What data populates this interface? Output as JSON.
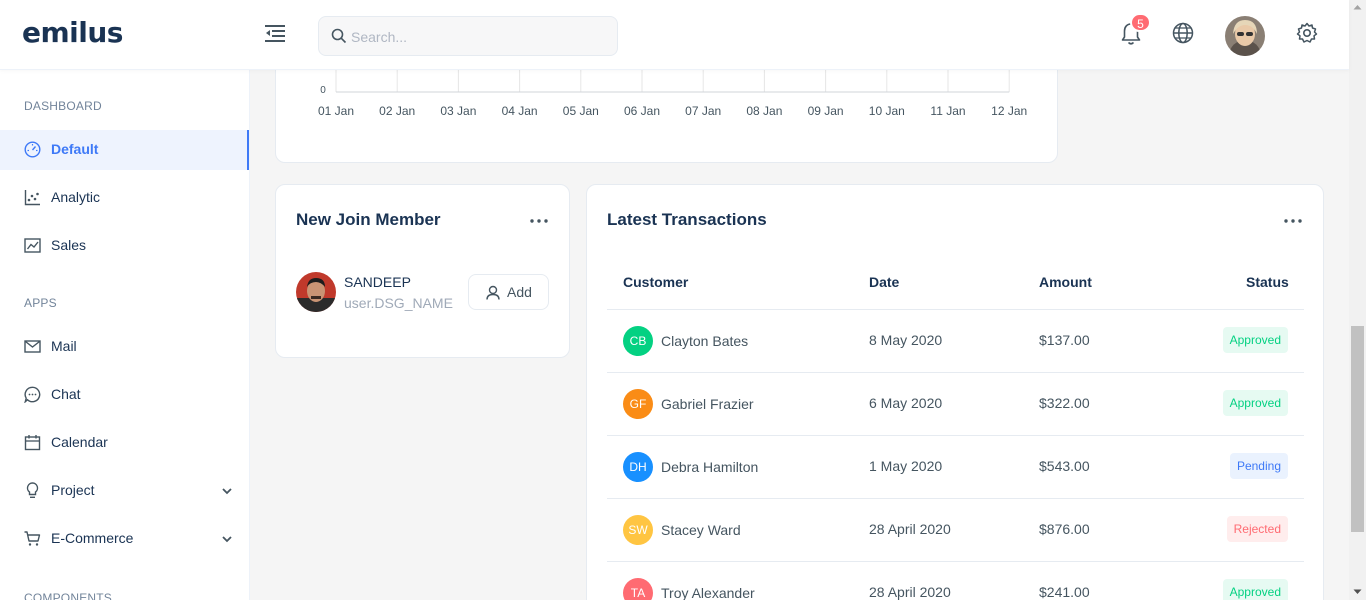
{
  "header": {
    "logo": "emilus",
    "search_placeholder": "Search...",
    "notification_count": "5"
  },
  "sidebar": {
    "sections": [
      {
        "title": "DASHBOARD"
      },
      {
        "title": "APPS"
      },
      {
        "title": "COMPONENTS"
      }
    ],
    "items": [
      {
        "label": "Default",
        "icon": "dashboard-icon"
      },
      {
        "label": "Analytic",
        "icon": "dot-chart-icon"
      },
      {
        "label": "Sales",
        "icon": "line-chart-icon"
      },
      {
        "label": "Mail",
        "icon": "mail-icon"
      },
      {
        "label": "Chat",
        "icon": "chat-icon"
      },
      {
        "label": "Calendar",
        "icon": "calendar-icon"
      },
      {
        "label": "Project",
        "icon": "bulb-icon"
      },
      {
        "label": "E-Commerce",
        "icon": "cart-icon"
      }
    ]
  },
  "chart": {
    "y_zero_label": "0",
    "x_labels": [
      "01 Jan",
      "02 Jan",
      "03 Jan",
      "04 Jan",
      "05 Jan",
      "06 Jan",
      "07 Jan",
      "08 Jan",
      "09 Jan",
      "10 Jan",
      "11 Jan",
      "12 Jan"
    ]
  },
  "member_card": {
    "title": "New Join Member",
    "member": {
      "name": "SANDEEP",
      "role": "user.DSG_NAME"
    },
    "add_label": "Add"
  },
  "transactions": {
    "title": "Latest Transactions",
    "columns": [
      "Customer",
      "Date",
      "Amount",
      "Status"
    ],
    "rows": [
      {
        "initials": "CB",
        "name": "Clayton Bates",
        "date": "8 May 2020",
        "amount": "$137.00",
        "status": "Approved"
      },
      {
        "initials": "GF",
        "name": "Gabriel Frazier",
        "date": "6 May 2020",
        "amount": "$322.00",
        "status": "Approved"
      },
      {
        "initials": "DH",
        "name": "Debra Hamilton",
        "date": "1 May 2020",
        "amount": "$543.00",
        "status": "Pending"
      },
      {
        "initials": "SW",
        "name": "Stacey Ward",
        "date": "28 April 2020",
        "amount": "$876.00",
        "status": "Rejected"
      },
      {
        "initials": "TA",
        "name": "Troy Alexander",
        "date": "28 April 2020",
        "amount": "$241.00",
        "status": "Approved"
      }
    ]
  },
  "colors": {
    "primary": "#3e79f7",
    "avatar_colors": [
      "#04d182",
      "#fa8c16",
      "#1890ff",
      "#ffc542",
      "#ff6b72"
    ],
    "approved_bg": "#e6faf2",
    "approved_fg": "#04d182",
    "pending_bg": "#eaf2fe",
    "pending_fg": "#3e79f7",
    "rejected_bg": "#ffeded",
    "rejected_fg": "#ff6b72"
  }
}
